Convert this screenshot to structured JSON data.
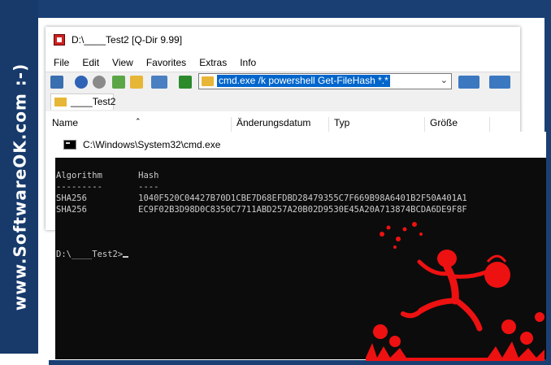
{
  "branding": {
    "vertical_text": "www.SoftwareOK.com :-)"
  },
  "qdir": {
    "title": "D:\\____Test2  [Q-Dir 9.99]",
    "menu": [
      "File",
      "Edit",
      "View",
      "Favorites",
      "Extras",
      "Info"
    ],
    "address": {
      "value": "cmd.exe /k powershell Get-FileHash *.*"
    },
    "tab_label": "____Test2",
    "columns": [
      "Name",
      "Änderungsdatum",
      "Typ",
      "Größe"
    ]
  },
  "cmd": {
    "title": "C:\\Windows\\System32\\cmd.exe",
    "lines": [
      "Algorithm       Hash",
      "---------       ----",
      "SHA256          1040F520C04427B70D1CBE7D68EFDBD28479355C7F669B98A6401B2F50A401A1",
      "SHA256          EC9F02B3D98D0C8350C7711ABD257A20B02D9530E45A20A713874BCDA6DE9F8F",
      "D:\\____Test2>"
    ]
  },
  "colors": {
    "frame_blue": "#1a3f73",
    "console_bg": "#0c0c0c",
    "console_text": "#cccccc",
    "selection": "#0066cc",
    "mascot_red": "#ee1111"
  }
}
